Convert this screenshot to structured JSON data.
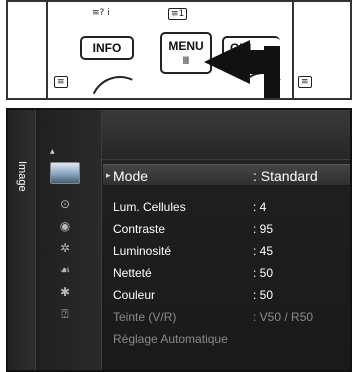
{
  "remote": {
    "info_icon": "≡? i",
    "info_label": "INFO",
    "menu_icon": "≡1",
    "menu_label": "MENU",
    "menu_glyph": "Ⅲ",
    "guide_label": "GUI",
    "left_tag": "≡",
    "right_tag": "≡",
    "pointer_color": "#111111"
  },
  "tv_menu": {
    "category": "Image",
    "items": [
      {
        "label": "Mode",
        "value": ": Standard",
        "icon": "picture-icon",
        "selected": true
      },
      {
        "label": "Lum. Cellules",
        "value": ": 4",
        "icon": "sound-icon"
      },
      {
        "label": "Contraste",
        "value": ": 95",
        "icon": "channel-icon"
      },
      {
        "label": "Luminosité",
        "value": ": 45",
        "icon": "setup-icon"
      },
      {
        "label": "Netteté",
        "value": ": 50",
        "icon": "input-icon"
      },
      {
        "label": "Couleur",
        "value": ": 50",
        "icon": "application-icon"
      },
      {
        "label": "Teinte (V/R)",
        "value": ": V50 / R50",
        "icon": "support-icon",
        "disabled": true
      },
      {
        "label": "Réglage Automatique",
        "value": "",
        "disabled": true
      }
    ],
    "colors": {
      "panel_bg": "#1e1e1e",
      "text": "#ffffff",
      "disabled_text": "#8a8a8a",
      "selected_row": "#3c3c3c"
    }
  }
}
